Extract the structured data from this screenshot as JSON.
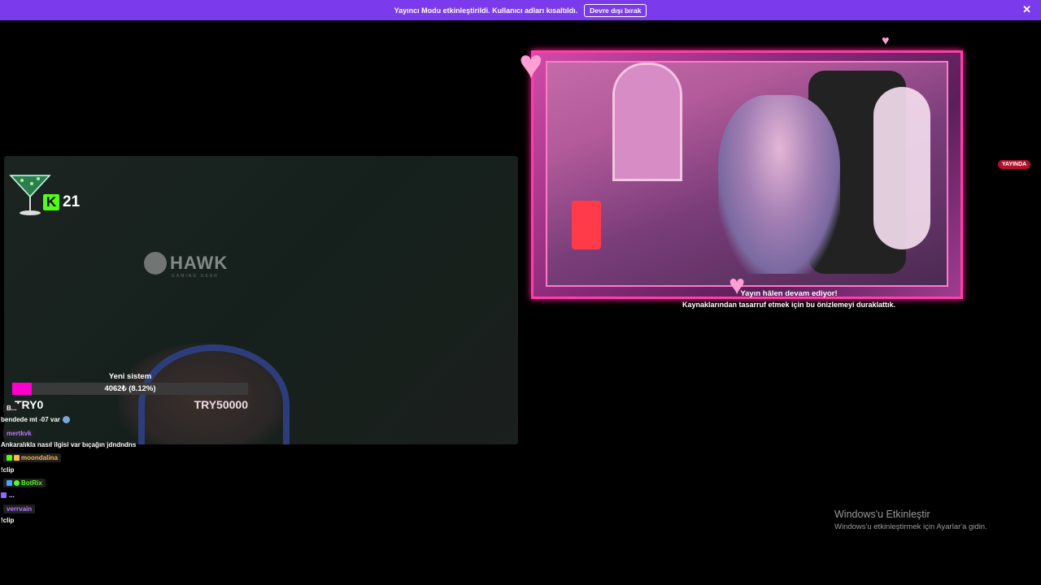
{
  "banner": {
    "text": "Yayıncı Modu etkinleştirildi. Kullanıcı adları kısaltıldı.",
    "button": "Devre dışı bırak",
    "close_icon": "close-icon"
  },
  "left_stream": {
    "kick_count": "21",
    "watermark": "HAWK",
    "watermark_sub": "GAMING GEAR",
    "goal": {
      "title": "Yeni sistem",
      "value": "4062₺ (8.12%)",
      "progress_percent": 8.12,
      "start_label": "TRY0",
      "end_label": "TRY50000"
    }
  },
  "chat": [
    {
      "user": "B...",
      "message": "bendede mt -07 var",
      "user_color": "#ffffff"
    },
    {
      "user": "mertkvk",
      "message": "Ankaralıkla nasıl ilgisi var bıçağın jdndndns",
      "user_color": "#b57cff"
    },
    {
      "user": "moondalina",
      "message": "!clip",
      "user_color": "#ffb84d"
    },
    {
      "user": "BotRix",
      "message": "...",
      "user_color": "#53fc18"
    },
    {
      "user": "verrvain",
      "message": "!clip",
      "user_color": "#b57cff"
    }
  ],
  "right_stream": {
    "live_badge": "YAYINDA",
    "status_line1": "Yayın hâlen devam ediyor!",
    "status_line2": "Kaynaklarından tasarruf etmek için bu önizlemeyi duraklattık."
  },
  "windows_activation": {
    "title": "Windows'u Etkinleştir",
    "subtitle": "Windows'u etkinleştirmek için Ayarlar'a gidin."
  }
}
